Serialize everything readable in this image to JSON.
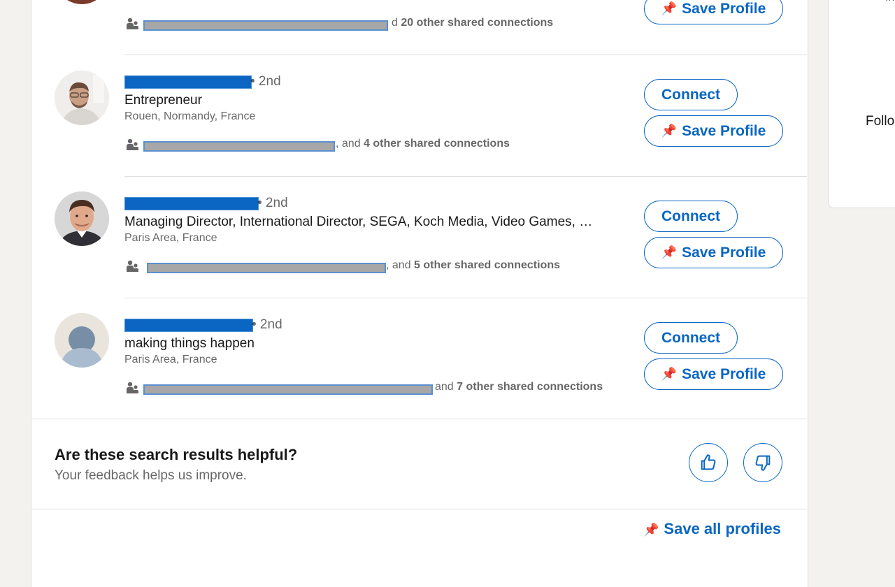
{
  "results": [
    {
      "degree": "",
      "headline": "",
      "location": "",
      "shared_prefix": "d",
      "shared_count": "20 other shared connections",
      "connect_label": "",
      "save_label": "Save Profile"
    },
    {
      "degree": "• 2nd",
      "headline": "Entrepreneur",
      "location": "Rouen, Normandy, France",
      "shared_prefix": ", and",
      "shared_count": "4 other shared connections",
      "connect_label": "Connect",
      "save_label": "Save Profile"
    },
    {
      "degree": "• 2nd",
      "headline": "Managing Director, International Director, SEGA, Koch Media, Video Games, …",
      "location": "Paris Area, France",
      "shared_prefix": ", and",
      "shared_count": "5 other shared connections",
      "connect_label": "Connect",
      "save_label": "Save Profile"
    },
    {
      "degree": "• 2nd",
      "headline": "making things happen",
      "location": "Paris Area, France",
      "shared_prefix": "and",
      "shared_count": "7 other shared connections",
      "connect_label": "Connect",
      "save_label": "Save Profile"
    }
  ],
  "feedback": {
    "title": "Are these search results helpful?",
    "subtitle": "Your feedback helps us improve.",
    "thumbs_up_icon": "thumbs-up-icon",
    "thumbs_down_icon": "thumbs-down-icon"
  },
  "footer": {
    "save_all_label": "Save all profiles",
    "pin_icon": "pushpin-icon"
  },
  "sidebar": {
    "partial_text": "Follo",
    "partial_top": "In"
  },
  "colors": {
    "accent": "#0a66c2",
    "background": "#f3f2ef",
    "card": "#ffffff"
  }
}
